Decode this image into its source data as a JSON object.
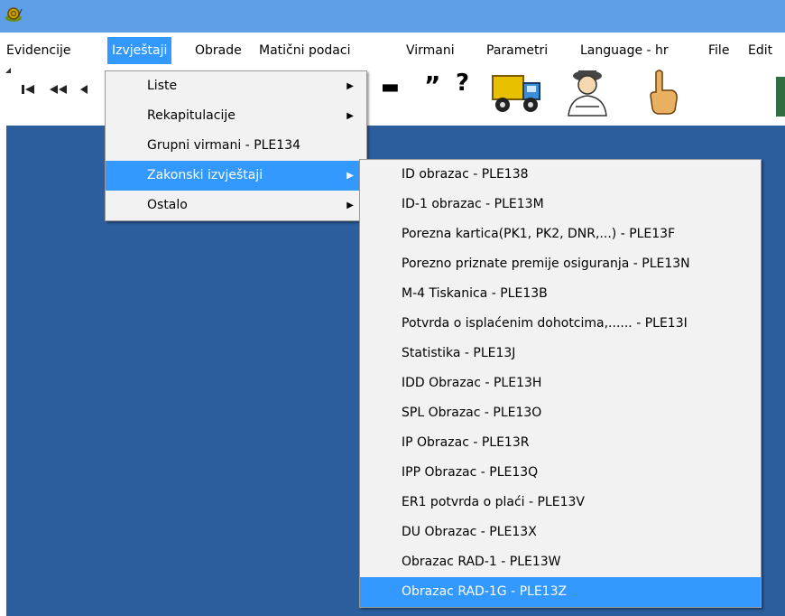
{
  "menubar": {
    "items": [
      "Evidencije",
      "Izvještaji",
      "Obrade",
      "Matični podaci",
      "Virmani",
      "Parametri",
      "Language - hr",
      "File",
      "Edit"
    ]
  },
  "toolbar": {
    "first_icon": "first-record-icon",
    "prev_icon": "previous-page-icon",
    "minus_glyph": "▬",
    "quote_glyph": "”",
    "help_glyph": "?"
  },
  "izvjestaji_menu": {
    "items": [
      "Liste",
      "Rekapitulacije",
      "Grupni virmani - PLE134",
      "Zakonski izvještaji",
      "Ostalo"
    ],
    "arrow": "▶"
  },
  "zakonski_menu": {
    "items": [
      "ID obrazac - PLE138",
      "ID-1 obrazac - PLE13M",
      "Porezna kartica(PK1, PK2, DNR,...) - PLE13F",
      "Porezno priznate premije osiguranja - PLE13N",
      "M-4 Tiskanica - PLE13B",
      "Potvrda o isplaćenim dohotcima,...... - PLE13I",
      "Statistika - PLE13J",
      "IDD Obrazac - PLE13H",
      "SPL Obrazac - PLE13O",
      "IP Obrazac - PLE13R",
      "IPP Obrazac - PLE13Q",
      "ER1 potvrda o plaći - PLE13V",
      "DU Obrazac - PLE13X",
      "Obrazac RAD-1 - PLE13W",
      "Obrazac RAD-1G - PLE13Z"
    ]
  },
  "colors": {
    "titlebar": "#5f9fe8",
    "highlight": "#3399ff",
    "workspace": "#2c5e9e"
  }
}
